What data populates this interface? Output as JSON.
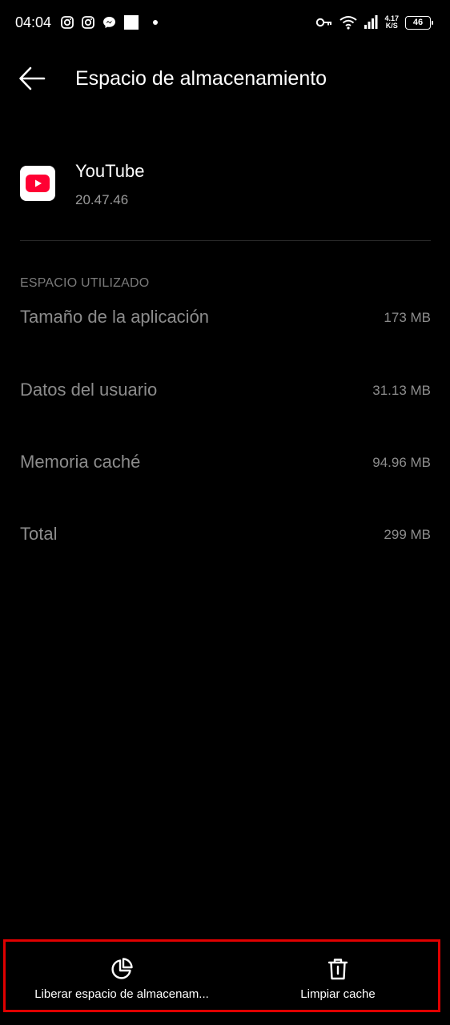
{
  "status_bar": {
    "time": "04:04",
    "left_icons": [
      "instagram-icon",
      "instagram-icon",
      "messenger-icon",
      "square-icon",
      "dot-icon"
    ],
    "right_icons": [
      "key-icon",
      "wifi-icon",
      "signal-icon"
    ],
    "speed_value": "4.17",
    "speed_unit": "K/S",
    "battery": "46"
  },
  "header": {
    "back_icon": "arrow-left-icon",
    "title": "Espacio de almacenamiento"
  },
  "app": {
    "icon": "youtube-icon",
    "name": "YouTube",
    "version": "20.47.46"
  },
  "storage": {
    "section_title": "ESPACIO UTILIZADO",
    "rows": [
      {
        "label": "Tamaño de la aplicación",
        "value": "173 MB"
      },
      {
        "label": "Datos del usuario",
        "value": "31.13 MB"
      },
      {
        "label": "Memoria caché",
        "value": "94.96 MB"
      },
      {
        "label": "Total",
        "value": "299 MB"
      }
    ]
  },
  "actions": {
    "free_space": {
      "icon": "pie-chart-icon",
      "label": "Liberar espacio de almacenam..."
    },
    "clear_cache": {
      "icon": "trash-icon",
      "label": "Limpiar cache"
    }
  },
  "colors": {
    "background": "#000000",
    "highlight_border": "#e00000",
    "youtube_red": "#ff0033",
    "secondary_text": "#8c8c8c"
  }
}
